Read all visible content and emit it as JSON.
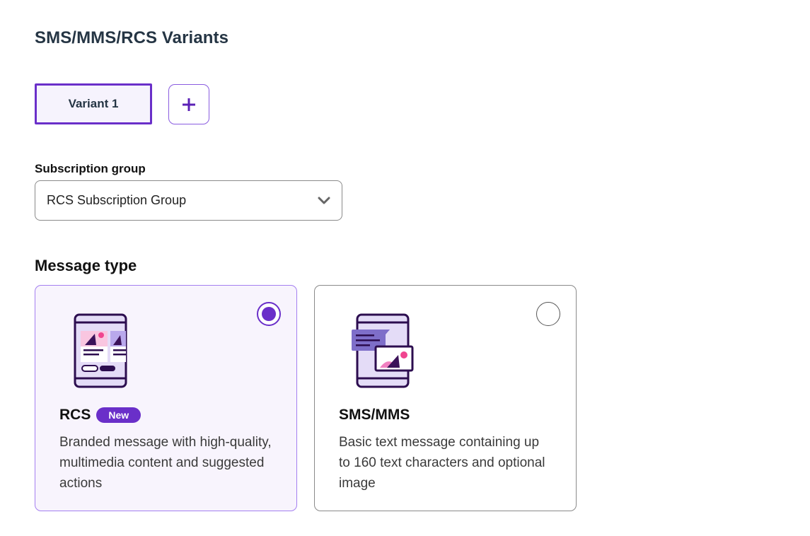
{
  "section_title": "SMS/MMS/RCS Variants",
  "variants": {
    "tab_label": "Variant 1",
    "add_icon": "plus-icon"
  },
  "subscription_group": {
    "label": "Subscription group",
    "selected_value": "RCS Subscription Group",
    "chevron_icon": "chevron-down-icon"
  },
  "message_type": {
    "label": "Message type",
    "options": [
      {
        "title": "RCS",
        "badge": "New",
        "description": "Branded message with high-quality, multimedia content and suggested actions",
        "selected": true,
        "icon": "rcs-phone-illustration"
      },
      {
        "title": "SMS/MMS",
        "badge": "",
        "description": "Basic text message containing up to 160 text characters and optional image",
        "selected": false,
        "icon": "sms-phone-illustration"
      }
    ]
  },
  "colors": {
    "accent": "#6a2fc9",
    "selected_card_bg": "#f8f4fd",
    "title_text": "#253544"
  }
}
